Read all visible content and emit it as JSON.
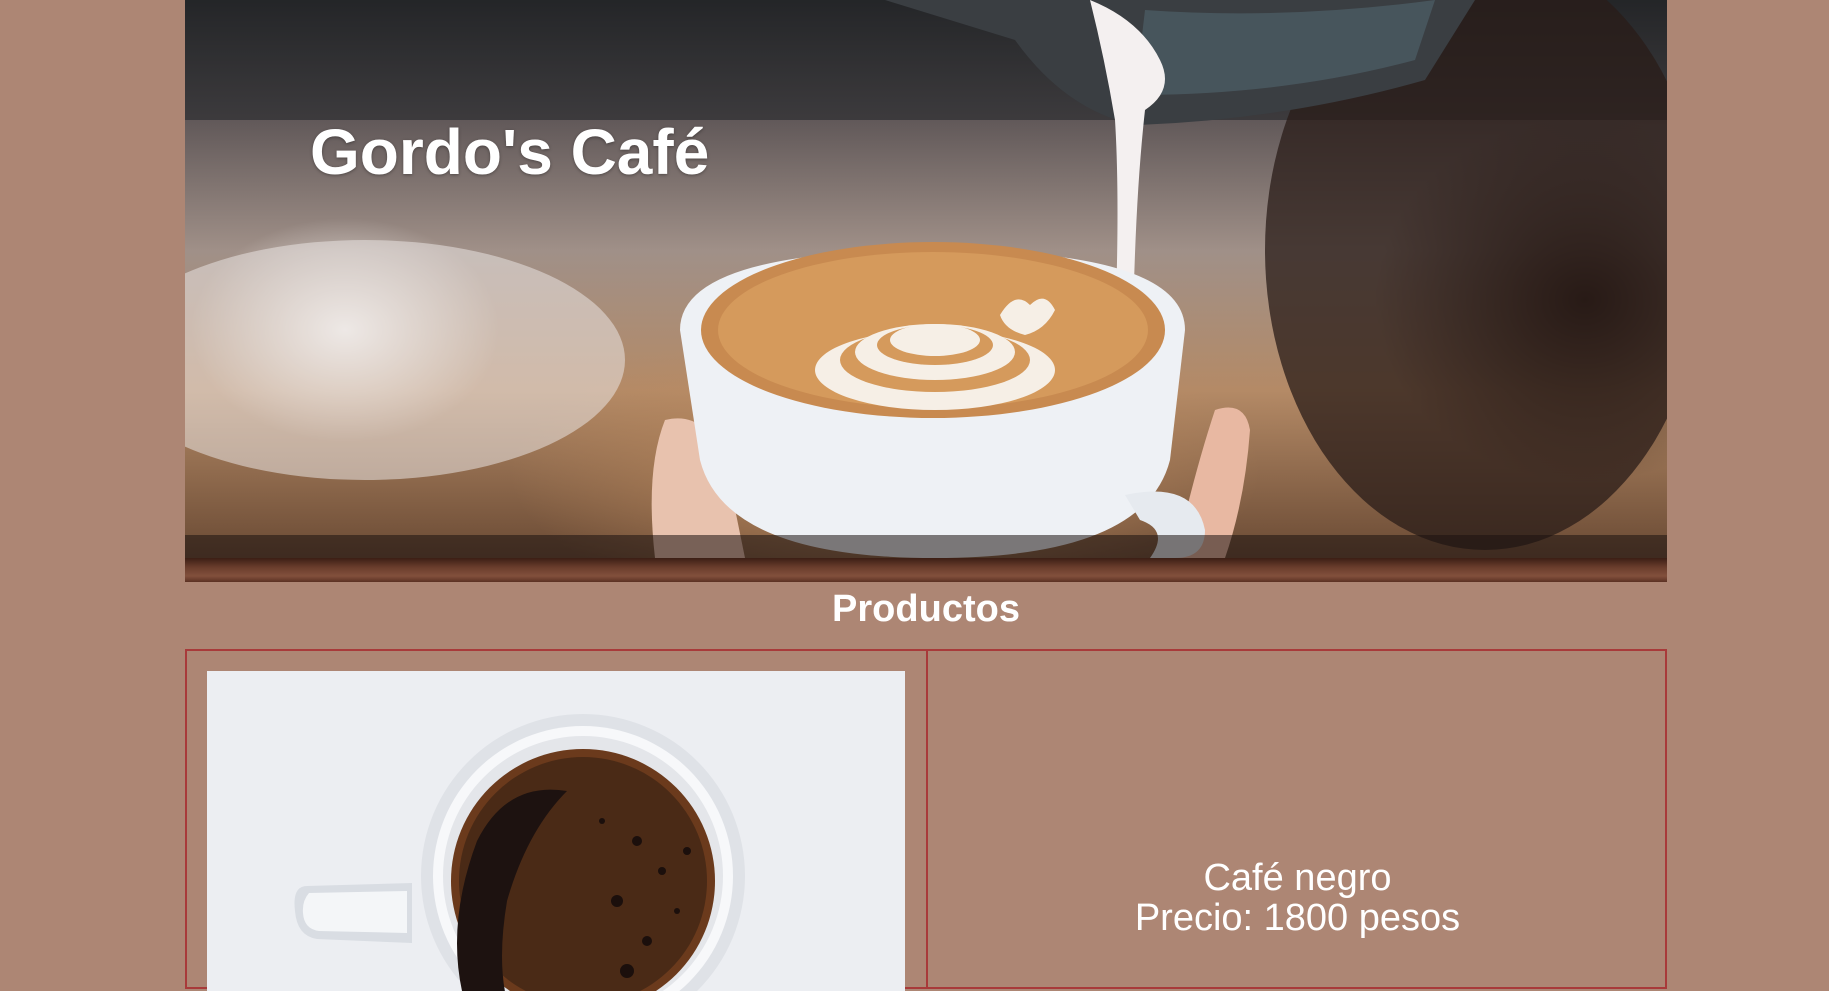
{
  "hero": {
    "title": "Gordo's Café"
  },
  "section": {
    "title": "Productos"
  },
  "products": [
    {
      "name": "Café negro",
      "price": "Precio: 1800 pesos"
    }
  ],
  "colors": {
    "background": "#ad8674",
    "border": "#a83a3a",
    "text": "#ffffff",
    "bar": "#6b3e2d"
  }
}
